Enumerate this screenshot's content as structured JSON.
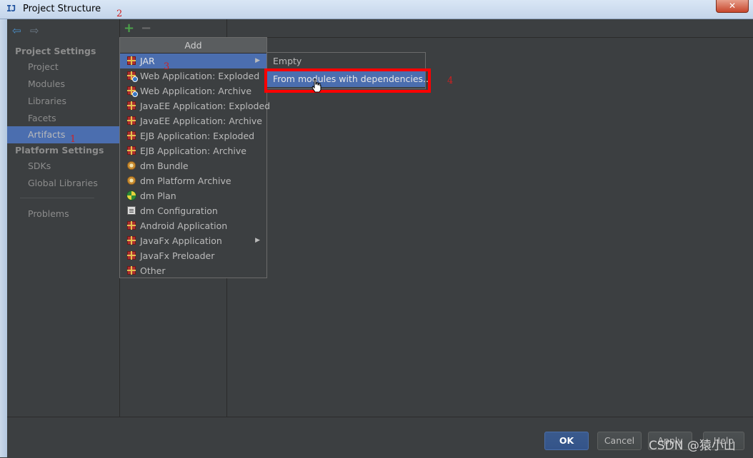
{
  "window": {
    "title": "Project Structure",
    "app_icon": "IJ",
    "close_glyph": "✕"
  },
  "sidebar": {
    "nav_back": "⇦",
    "nav_forward": "⇨",
    "project_settings_title": "Project Settings",
    "project_items": [
      "Project",
      "Modules",
      "Libraries",
      "Facets",
      "Artifacts"
    ],
    "selected_item": "Artifacts",
    "platform_settings_title": "Platform Settings",
    "platform_items": [
      "SDKs",
      "Global Libraries"
    ],
    "problems": "Problems"
  },
  "toolbar": {
    "add_glyph": "+",
    "remove_glyph": "−"
  },
  "add_menu": {
    "header": "Add",
    "items": [
      {
        "label": "JAR",
        "icon": "gift-icon",
        "has_submenu": true,
        "selected": true
      },
      {
        "label": "Web Application: Exploded",
        "icon": "gift-web-icon"
      },
      {
        "label": "Web Application: Archive",
        "icon": "gift-web-icon"
      },
      {
        "label": "JavaEE Application: Exploded",
        "icon": "gift-icon"
      },
      {
        "label": "JavaEE Application: Archive",
        "icon": "gift-icon"
      },
      {
        "label": "EJB Application: Exploded",
        "icon": "gift-icon"
      },
      {
        "label": "EJB Application: Archive",
        "icon": "gift-icon"
      },
      {
        "label": "dm Bundle",
        "icon": "flower-icon"
      },
      {
        "label": "dm Platform Archive",
        "icon": "flower-icon"
      },
      {
        "label": "dm Plan",
        "icon": "globe-icon"
      },
      {
        "label": "dm Configuration",
        "icon": "document-icon"
      },
      {
        "label": "Android Application",
        "icon": "gift-icon"
      },
      {
        "label": "JavaFx Application",
        "icon": "gift-icon",
        "has_submenu": true
      },
      {
        "label": "JavaFx Preloader",
        "icon": "gift-icon"
      },
      {
        "label": "Other",
        "icon": "gift-icon"
      }
    ]
  },
  "jar_submenu": {
    "items": [
      "Empty",
      "From modules with dependencies..."
    ],
    "highlighted": "From modules with dependencies..."
  },
  "annotations": {
    "step1": "1",
    "step2": "2",
    "step3": "3",
    "step4": "4",
    "highlight_color": "#ff0000"
  },
  "buttons": {
    "ok": "OK",
    "cancel": "Cancel",
    "apply": "Apply",
    "help": "Help"
  },
  "watermark": "CSDN @猿小山",
  "colors": {
    "background": "#3c3f41",
    "selection": "#4b6eaf"
  }
}
